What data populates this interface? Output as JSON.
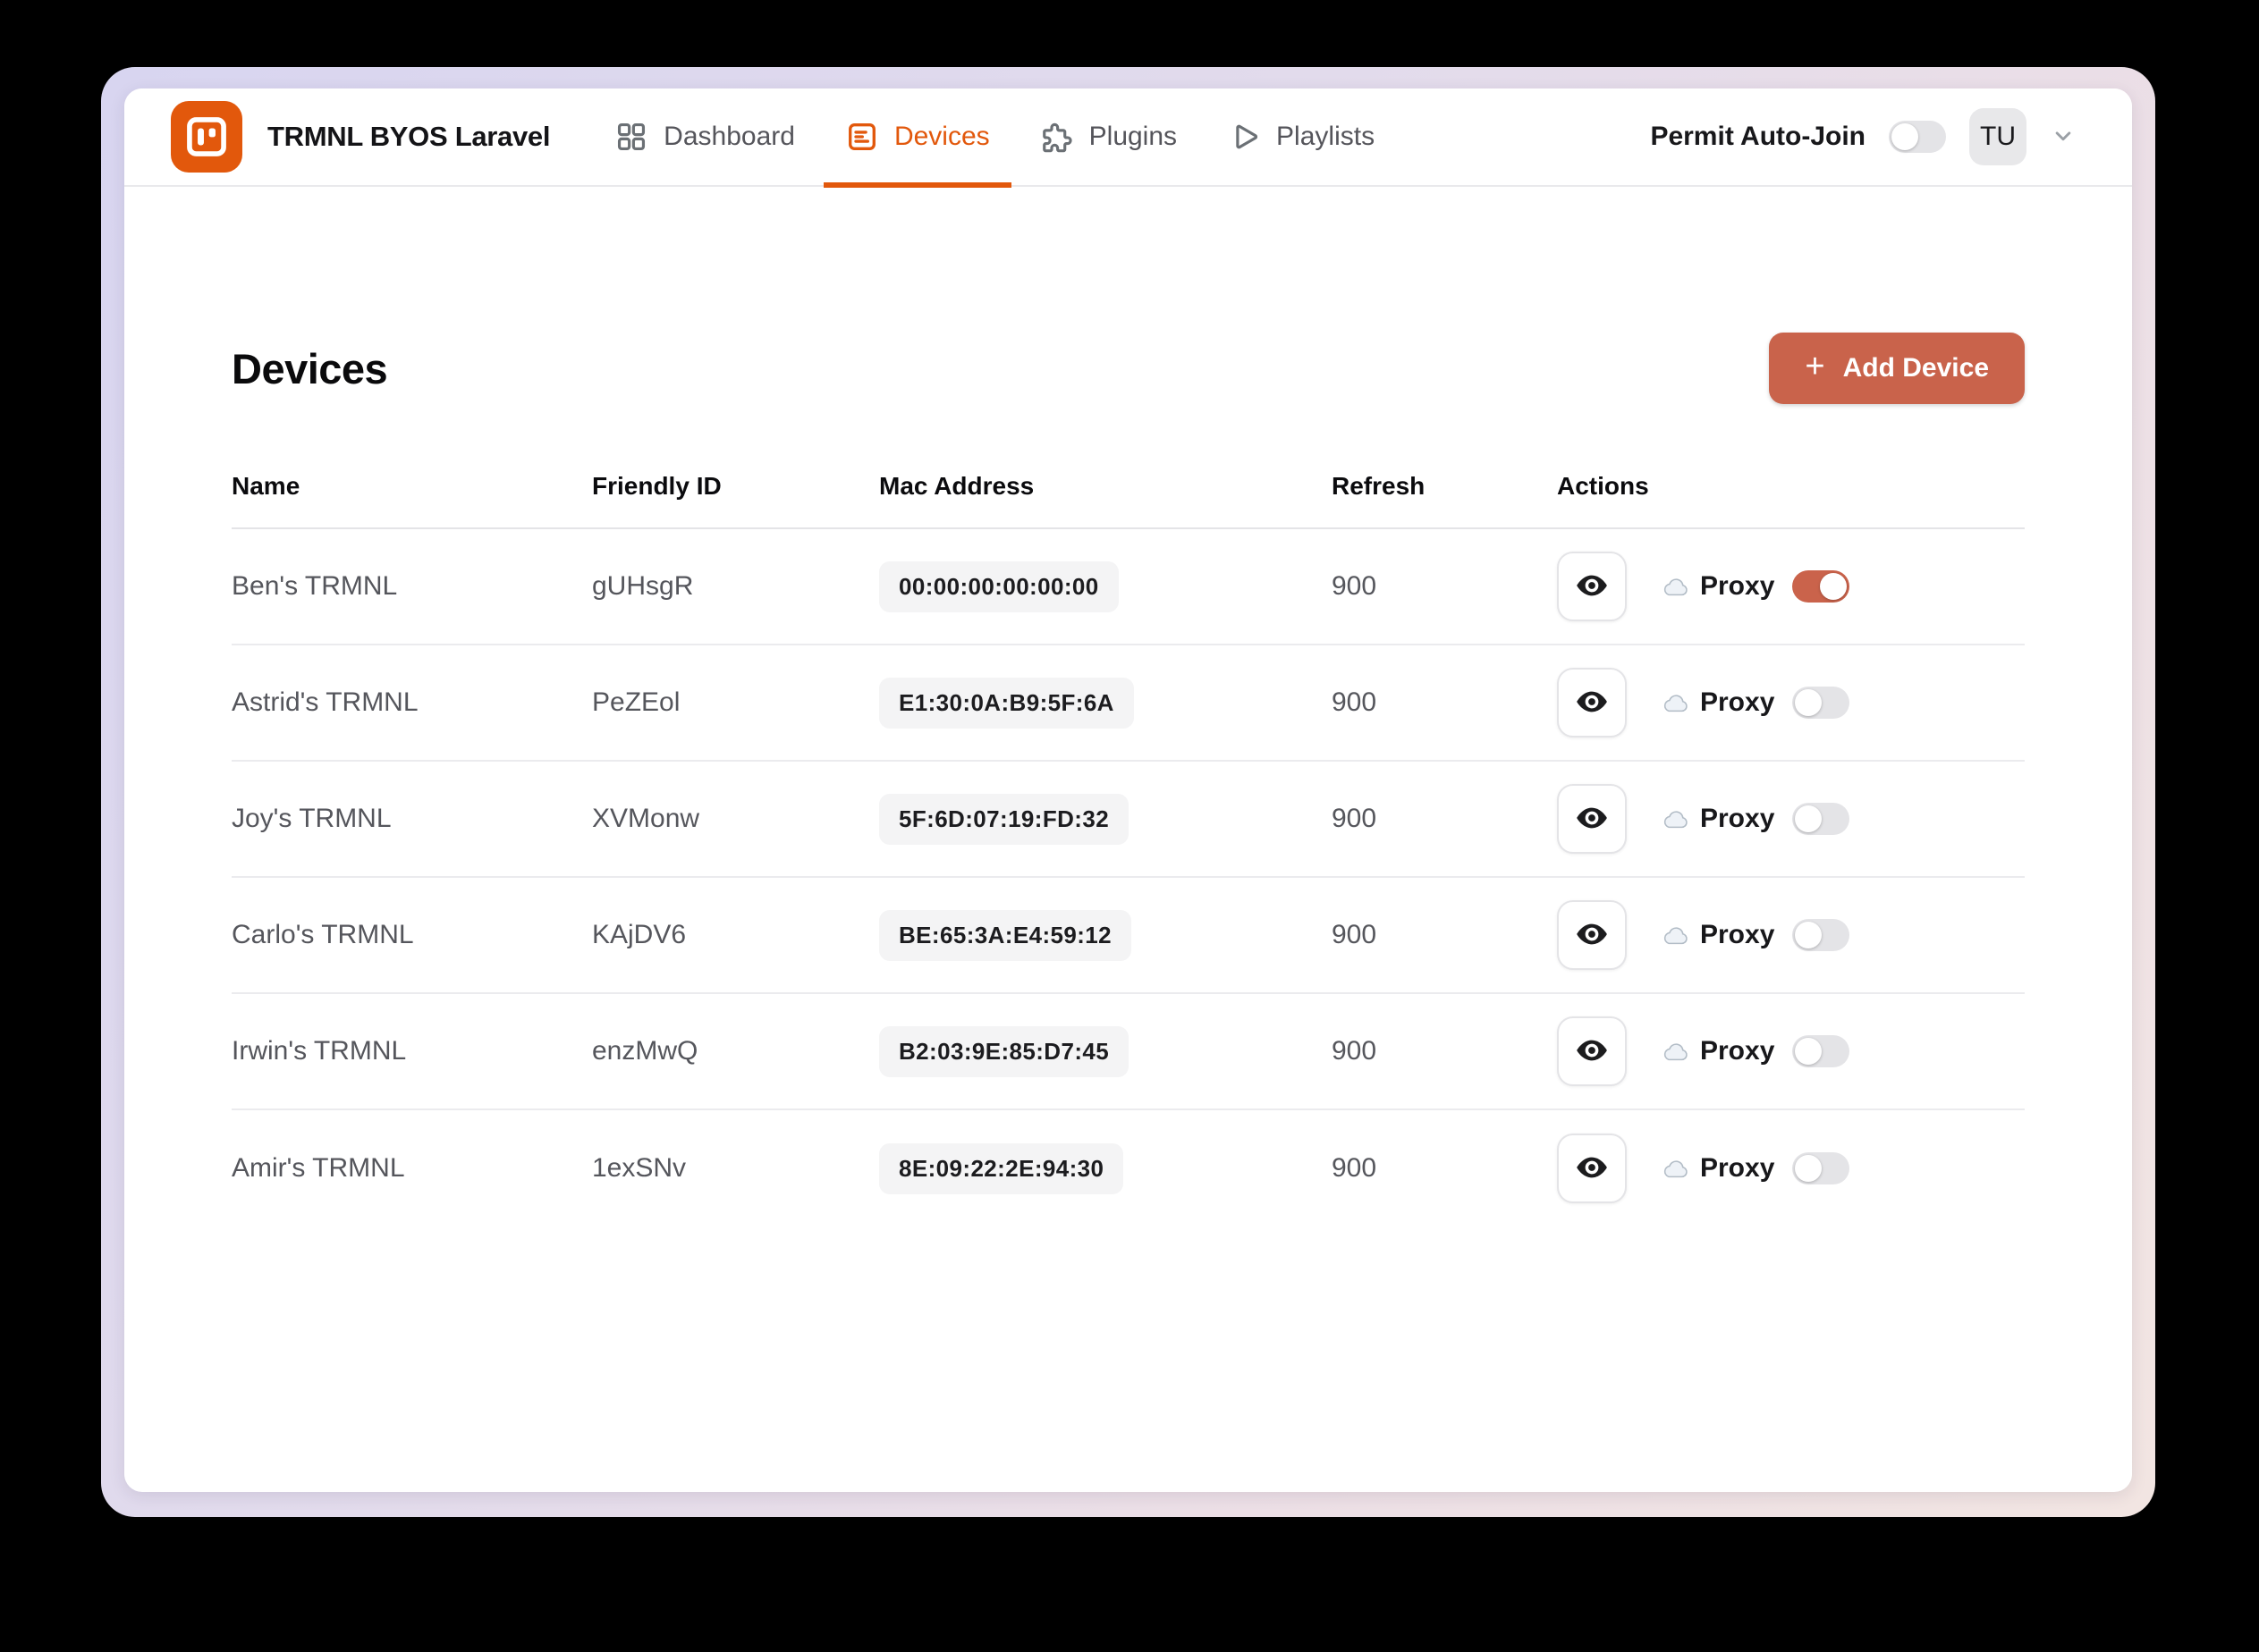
{
  "app": {
    "title": "TRMNL BYOS Laravel",
    "logo_icon": "trmnl-device-icon"
  },
  "nav": [
    {
      "label": "Dashboard",
      "icon": "grid-icon",
      "active": false
    },
    {
      "label": "Devices",
      "icon": "list-box-icon",
      "active": true
    },
    {
      "label": "Plugins",
      "icon": "puzzle-icon",
      "active": false
    },
    {
      "label": "Playlists",
      "icon": "play-icon",
      "active": false
    }
  ],
  "top_right": {
    "permit_label": "Permit Auto-Join",
    "permit_toggle_on": false,
    "avatar_initials": "TU",
    "menu_icon": "chevron-down-icon"
  },
  "page": {
    "title": "Devices",
    "add_button_label": "Add Device",
    "add_button_icon": "plus-icon"
  },
  "table": {
    "columns": [
      "Name",
      "Friendly ID",
      "Mac Address",
      "Refresh",
      "Actions"
    ],
    "proxy_label": "Proxy",
    "action_icons": [
      "eye-icon",
      "cloud-icon"
    ],
    "rows": [
      {
        "name": "Ben's TRMNL",
        "friendly_id": "gUHsgR",
        "mac": "00:00:00:00:00:00",
        "refresh": "900",
        "proxy_on": true
      },
      {
        "name": "Astrid's TRMNL",
        "friendly_id": "PeZEol",
        "mac": "E1:30:0A:B9:5F:6A",
        "refresh": "900",
        "proxy_on": false
      },
      {
        "name": "Joy's TRMNL",
        "friendly_id": "XVMonw",
        "mac": "5F:6D:07:19:FD:32",
        "refresh": "900",
        "proxy_on": false
      },
      {
        "name": "Carlo's TRMNL",
        "friendly_id": "KAjDV6",
        "mac": "BE:65:3A:E4:59:12",
        "refresh": "900",
        "proxy_on": false
      },
      {
        "name": "Irwin's TRMNL",
        "friendly_id": "enzMwQ",
        "mac": "B2:03:9E:85:D7:45",
        "refresh": "900",
        "proxy_on": false
      },
      {
        "name": "Amir's TRMNL",
        "friendly_id": "1exSNv",
        "mac": "8E:09:22:2E:94:30",
        "refresh": "900",
        "proxy_on": false
      }
    ]
  },
  "colors": {
    "accent_orange": "#e2580c",
    "button_salmon": "#c9634b",
    "toggle_on": "#ca634b",
    "toggle_off": "#e4e4e7",
    "badge_bg": "#f4f4f5",
    "frame_gradient_start": "#d8d5f0",
    "frame_gradient_end": "#f2e5e2"
  }
}
